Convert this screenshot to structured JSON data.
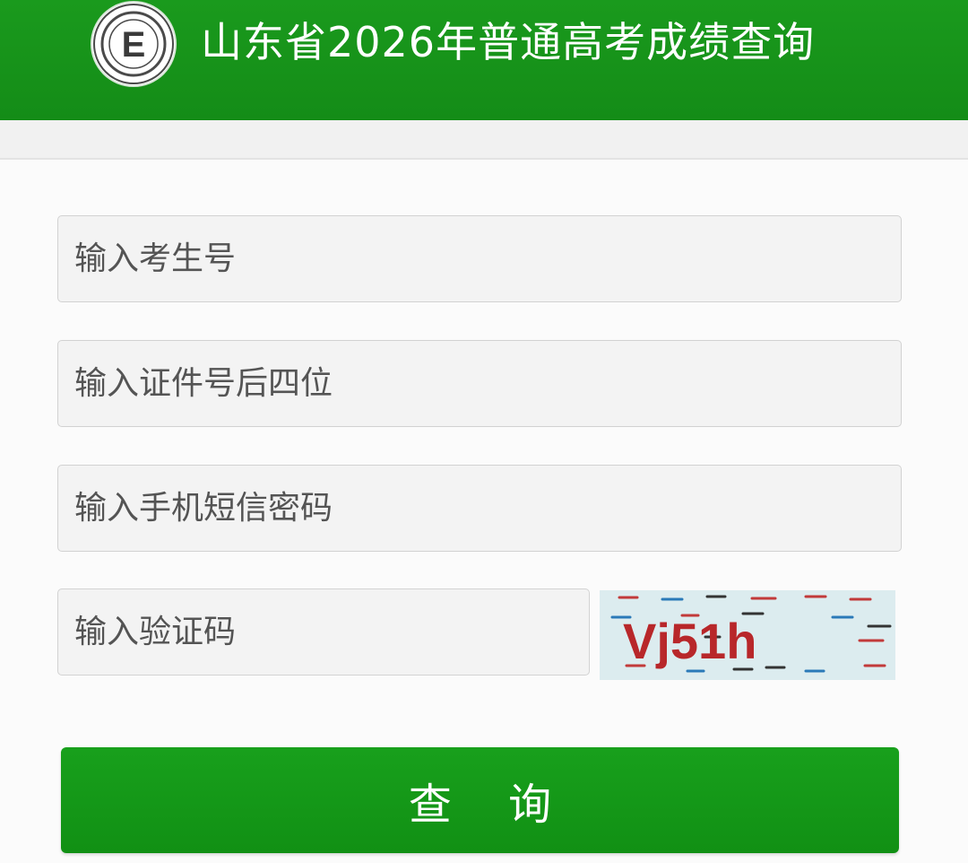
{
  "header": {
    "title": "山东省2026年普通高考成绩查询",
    "logo_icon": "exam-authority-seal-icon",
    "logo_letter": "E",
    "background": "#169318"
  },
  "form": {
    "exam_number": {
      "placeholder": "输入考生号",
      "value": ""
    },
    "id_last4": {
      "placeholder": "输入证件号后四位",
      "value": ""
    },
    "sms_code": {
      "placeholder": "输入手机短信密码",
      "value": ""
    },
    "captcha_input": {
      "placeholder": "输入验证码",
      "value": ""
    },
    "captcha_text": "Vj51h"
  },
  "submit": {
    "label": "查 询",
    "color": "#15961a"
  }
}
